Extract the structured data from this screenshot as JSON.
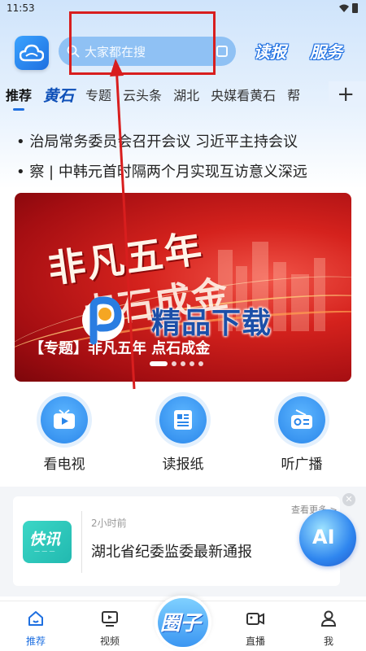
{
  "status_bar": {
    "time": "11:53"
  },
  "header": {
    "search_placeholder": "大家都在搜",
    "read_label": "读报",
    "service_label": "服务"
  },
  "tabs": [
    "推荐",
    "黄石",
    "专题",
    "云头条",
    "湖北",
    "央媒看黄石",
    "帮"
  ],
  "news_ticker": [
    "•       治局常务委员会召开会议 习近平主持会议",
    "•       察 | 中韩元首时隔两个月实现互访意义深远"
  ],
  "banner": {
    "art_title": "非凡五年",
    "art_subtitle": "点石成金",
    "caption": "【专题】非凡五年 点石成金",
    "slide_count": 5,
    "active_slide": 1
  },
  "watermark": {
    "text": "精品下载"
  },
  "quick_actions": [
    {
      "label": "看电视",
      "icon": "tv-icon"
    },
    {
      "label": "读报纸",
      "icon": "newspaper-icon"
    },
    {
      "label": "听广播",
      "icon": "radio-icon"
    }
  ],
  "kuaixun": {
    "brand": "快讯",
    "time_ago": "2小时前",
    "more": "查看更多 >",
    "headline": "湖北省纪委监委最新通报",
    "ai_label": "AI"
  },
  "bottom_nav": [
    {
      "label": "推荐",
      "icon": "home-icon",
      "active": true
    },
    {
      "label": "视频",
      "icon": "video-icon",
      "active": false
    },
    {
      "label": "圈子",
      "icon": "circle-icon",
      "active": false
    },
    {
      "label": "直播",
      "icon": "live-icon",
      "active": false
    },
    {
      "label": "我",
      "icon": "profile-icon",
      "active": false
    }
  ],
  "colors": {
    "accent": "#1e6fe0",
    "banner_red": "#d5221d",
    "annotation_red": "#d81e1e"
  }
}
